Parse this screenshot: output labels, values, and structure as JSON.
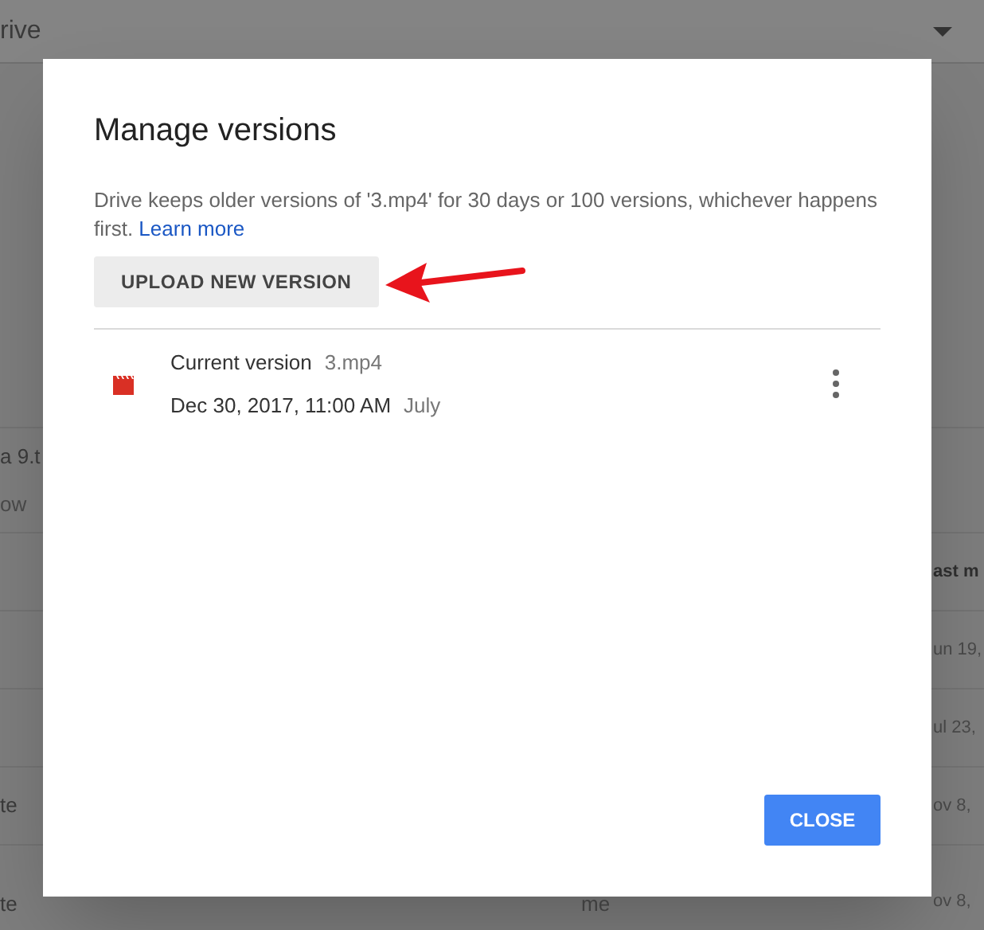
{
  "background": {
    "header": {
      "title": "rive"
    },
    "rows": [
      {
        "column_1": "a 9.t",
        "column_1_detail": "ow"
      },
      {
        "column_3": "ast m",
        "kind": "heading"
      },
      {
        "column_3": "un 19,"
      },
      {
        "column_3": "ul 23,"
      },
      {
        "column_1": "te",
        "column_3": "ov 8,"
      },
      {
        "column_1": "te",
        "column_2": "me",
        "column_3": "ov 8,"
      }
    ]
  },
  "dialog": {
    "title": "Manage versions",
    "description": "Drive keeps older versions of '3.mp4' for 30 days or 100 versions, whichever happens first.",
    "link": "Learn more",
    "upload_button": "UPLOAD NEW VERSION",
    "versions": [
      {
        "label": "Current version",
        "file": "3.mp4",
        "date": "Dec 30, 2017, 11:00 AM",
        "author": "July"
      }
    ],
    "close_button": "CLOSE"
  }
}
